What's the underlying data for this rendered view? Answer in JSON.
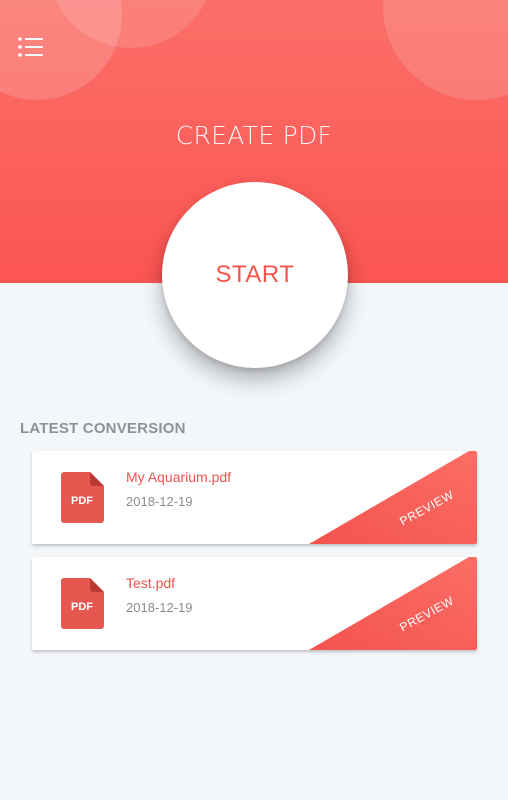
{
  "header": {
    "title": "CREATE PDF",
    "menu_icon": "list-menu-icon"
  },
  "start_button": {
    "label": "START"
  },
  "section": {
    "title": "LATEST CONVERSION"
  },
  "conversions": [
    {
      "file_name": "My Aquarium.pdf",
      "date": "2018-12-19",
      "icon_label": "PDF",
      "action_label": "PREVIEW"
    },
    {
      "file_name": "Test.pdf",
      "date": "2018-12-19",
      "icon_label": "PDF",
      "action_label": "PREVIEW"
    }
  ],
  "colors": {
    "accent": "#f5544e",
    "header_top": "#fb6f68",
    "header_bottom": "#fb5552",
    "background": "#f4f7fa",
    "muted_text": "#8a8e92"
  }
}
